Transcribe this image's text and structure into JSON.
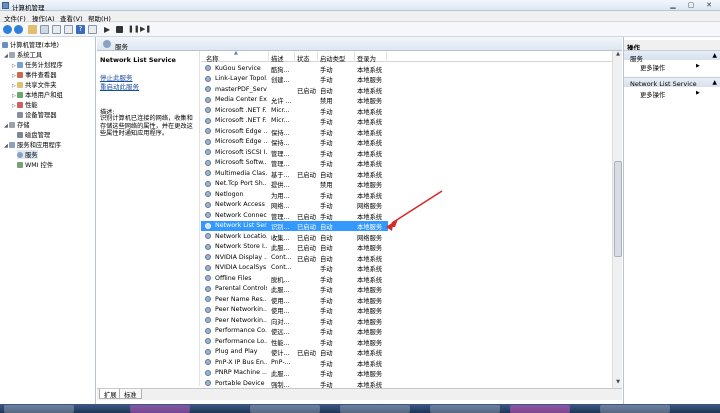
{
  "window": {
    "title": "计算机管理",
    "controls": [
      "minimize",
      "maximize",
      "close"
    ]
  },
  "menu": [
    "文件(F)",
    "操作(A)",
    "查看(V)",
    "帮助(H)"
  ],
  "tree": [
    {
      "label": "计算机管理(本地)",
      "depth": 0,
      "expanded": true
    },
    {
      "label": "系统工具",
      "depth": 1,
      "expanded": true
    },
    {
      "label": "任务计划程序",
      "depth": 2,
      "expandable": true
    },
    {
      "label": "事件查看器",
      "depth": 2,
      "expandable": true
    },
    {
      "label": "共享文件夹",
      "depth": 2,
      "expandable": true
    },
    {
      "label": "本地用户和组",
      "depth": 2,
      "expandable": true
    },
    {
      "label": "性能",
      "depth": 2,
      "expandable": true
    },
    {
      "label": "设备管理器",
      "depth": 2
    },
    {
      "label": "存储",
      "depth": 1,
      "expanded": true
    },
    {
      "label": "磁盘管理",
      "depth": 2
    },
    {
      "label": "服务和应用程序",
      "depth": 1,
      "expanded": true
    },
    {
      "label": "服务",
      "depth": 2
    },
    {
      "label": "WMI 控件",
      "depth": 2
    }
  ],
  "services_header": "服务",
  "detail": {
    "title": "Network List Service",
    "stop_text": "停止此服务",
    "restart_text": "重启动此服务",
    "desc_label": "描述:",
    "desc": "识别计算机已连接的网络，收集和存储这些网络的属性，并在更改这些属性时通知应用程序。"
  },
  "columns": [
    "名称",
    "描述",
    "状态",
    "启动类型",
    "登录为"
  ],
  "rows": [
    {
      "name": "KuGou Service",
      "desc": "酷狗...",
      "status": "",
      "startup": "手动",
      "logon": "本地系统"
    },
    {
      "name": "Link-Layer Topol...",
      "desc": "创建...",
      "status": "",
      "startup": "手动",
      "logon": "本地服务"
    },
    {
      "name": "masterPDF_Server",
      "desc": "",
      "status": "已启动",
      "startup": "自动",
      "logon": "本地系统"
    },
    {
      "name": "Media Center Ex...",
      "desc": "允许 ...",
      "status": "",
      "startup": "禁用",
      "logon": "本地服务"
    },
    {
      "name": "Microsoft .NET F...",
      "desc": "Micr...",
      "status": "",
      "startup": "手动",
      "logon": "本地系统"
    },
    {
      "name": "Microsoft .NET F...",
      "desc": "Micr...",
      "status": "",
      "startup": "手动",
      "logon": "本地系统"
    },
    {
      "name": "Microsoft Edge ...",
      "desc": "保持...",
      "status": "",
      "startup": "手动",
      "logon": "本地系统"
    },
    {
      "name": "Microsoft Edge ...",
      "desc": "保持...",
      "status": "",
      "startup": "手动",
      "logon": "本地系统"
    },
    {
      "name": "Microsoft iSCSI I...",
      "desc": "管理...",
      "status": "",
      "startup": "手动",
      "logon": "本地系统"
    },
    {
      "name": "Microsoft Softw...",
      "desc": "管理...",
      "status": "",
      "startup": "手动",
      "logon": "本地系统"
    },
    {
      "name": "Multimedia Clas...",
      "desc": "基于...",
      "status": "已启动",
      "startup": "自动",
      "logon": "本地系统"
    },
    {
      "name": "Net.Tcp Port Sh...",
      "desc": "提供...",
      "status": "",
      "startup": "禁用",
      "logon": "本地服务"
    },
    {
      "name": "Netlogon",
      "desc": "为用...",
      "status": "",
      "startup": "手动",
      "logon": "本地系统"
    },
    {
      "name": "Network Access ...",
      "desc": "网络...",
      "status": "",
      "startup": "手动",
      "logon": "网络服务"
    },
    {
      "name": "Network Connec...",
      "desc": "管理...",
      "status": "已启动",
      "startup": "手动",
      "logon": "本地系统"
    },
    {
      "name": "Network List Ser...",
      "desc": "识别...",
      "status": "已启动",
      "startup": "自动",
      "logon": "本地服务",
      "selected": true
    },
    {
      "name": "Network Locatio...",
      "desc": "收集...",
      "status": "已启动",
      "startup": "自动",
      "logon": "网络服务"
    },
    {
      "name": "Network Store I...",
      "desc": "此服...",
      "status": "已启动",
      "startup": "自动",
      "logon": "本地服务"
    },
    {
      "name": "NVIDIA Display ...",
      "desc": "Cont...",
      "status": "已启动",
      "startup": "自动",
      "logon": "本地系统"
    },
    {
      "name": "NVIDIA LocalSys...",
      "desc": "Cont...",
      "status": "",
      "startup": "手动",
      "logon": "本地系统"
    },
    {
      "name": "Offline Files",
      "desc": "脱机...",
      "status": "",
      "startup": "手动",
      "logon": "本地系统"
    },
    {
      "name": "Parental Controls",
      "desc": "此服...",
      "status": "",
      "startup": "手动",
      "logon": "本地服务"
    },
    {
      "name": "Peer Name Res...",
      "desc": "使用...",
      "status": "",
      "startup": "手动",
      "logon": "本地服务"
    },
    {
      "name": "Peer Networkin...",
      "desc": "使用...",
      "status": "",
      "startup": "手动",
      "logon": "本地服务"
    },
    {
      "name": "Peer Networkin...",
      "desc": "向对...",
      "status": "",
      "startup": "手动",
      "logon": "本地服务"
    },
    {
      "name": "Performance Co...",
      "desc": "使远...",
      "status": "",
      "startup": "手动",
      "logon": "本地服务"
    },
    {
      "name": "Performance Lo...",
      "desc": "性能...",
      "status": "",
      "startup": "手动",
      "logon": "本地服务"
    },
    {
      "name": "Plug and Play",
      "desc": "使计...",
      "status": "已启动",
      "startup": "自动",
      "logon": "本地系统"
    },
    {
      "name": "PnP-X IP Bus En...",
      "desc": "PnP-...",
      "status": "",
      "startup": "手动",
      "logon": "本地系统"
    },
    {
      "name": "PNRP Machine ...",
      "desc": "此服...",
      "status": "",
      "startup": "手动",
      "logon": "本地服务"
    },
    {
      "name": "Portable Device ...",
      "desc": "强制...",
      "status": "",
      "startup": "手动",
      "logon": "本地系统"
    }
  ],
  "tabs": [
    "扩展",
    "标准"
  ],
  "actions": {
    "heading": "操作",
    "sections": [
      {
        "title": "服务",
        "item": "更多操作"
      },
      {
        "title": "Network List Service",
        "item": "更多操作"
      }
    ]
  },
  "accent_colors": {
    "selection": "#3399ff",
    "annotation_arrow": "#d42b2b"
  }
}
